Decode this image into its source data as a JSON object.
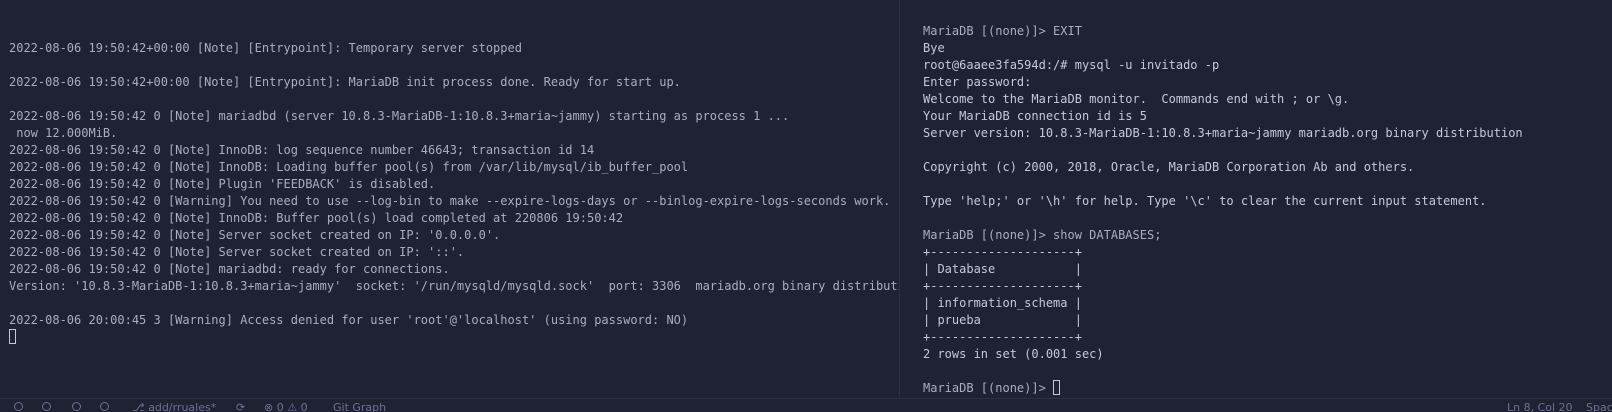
{
  "left_terminal": {
    "lines": [
      "",
      "2022-08-06 19:50:42+00:00 [Note] [Entrypoint]: Temporary server stopped",
      "",
      "2022-08-06 19:50:42+00:00 [Note] [Entrypoint]: MariaDB init process done. Ready for start up.",
      "",
      "2022-08-06 19:50:42 0 [Note] mariadbd (server 10.8.3-MariaDB-1:10.8.3+maria~jammy) starting as process 1 ...",
      " now 12.000MiB.",
      "2022-08-06 19:50:42 0 [Note] InnoDB: log sequence number 46643; transaction id 14",
      "2022-08-06 19:50:42 0 [Note] InnoDB: Loading buffer pool(s) from /var/lib/mysql/ib_buffer_pool",
      "2022-08-06 19:50:42 0 [Note] Plugin 'FEEDBACK' is disabled.",
      "2022-08-06 19:50:42 0 [Warning] You need to use --log-bin to make --expire-logs-days or --binlog-expire-logs-seconds work.",
      "2022-08-06 19:50:42 0 [Note] InnoDB: Buffer pool(s) load completed at 220806 19:50:42",
      "2022-08-06 19:50:42 0 [Note] Server socket created on IP: '0.0.0.0'.",
      "2022-08-06 19:50:42 0 [Note] Server socket created on IP: '::'.",
      "2022-08-06 19:50:42 0 [Note] mariadbd: ready for connections.",
      "Version: '10.8.3-MariaDB-1:10.8.3+maria~jammy'  socket: '/run/mysqld/mysqld.sock'  port: 3306  mariadb.org binary distribution",
      "",
      "2022-08-06 20:00:45 3 [Warning] Access denied for user 'root'@'localhost' (using password: NO)"
    ]
  },
  "right_terminal": {
    "lines": [
      "MariaDB [(none)]> EXIT",
      "Bye",
      "root@6aaee3fa594d:/# mysql -u invitado -p",
      "Enter password:",
      "Welcome to the MariaDB monitor.  Commands end with ; or \\g.",
      "Your MariaDB connection id is 5",
      "Server version: 10.8.3-MariaDB-1:10.8.3+maria~jammy mariadb.org binary distribution",
      "",
      "Copyright (c) 2000, 2018, Oracle, MariaDB Corporation Ab and others.",
      "",
      "Type 'help;' or '\\h' for help. Type '\\c' to clear the current input statement.",
      "",
      "MariaDB [(none)]> show DATABASES;",
      "+--------------------+",
      "| Database           |",
      "+--------------------+",
      "| information_schema |",
      "| prueba             |",
      "+--------------------+",
      "2 rows in set (0.001 sec)",
      ""
    ],
    "prompt": "MariaDB [(none)]> "
  },
  "statusbar": {
    "branch": "add/rruales*",
    "problems": "0 ⚠ 0",
    "git_graph": "Git Graph",
    "position": "Ln 8, Col 20",
    "spaces": "Spac"
  }
}
